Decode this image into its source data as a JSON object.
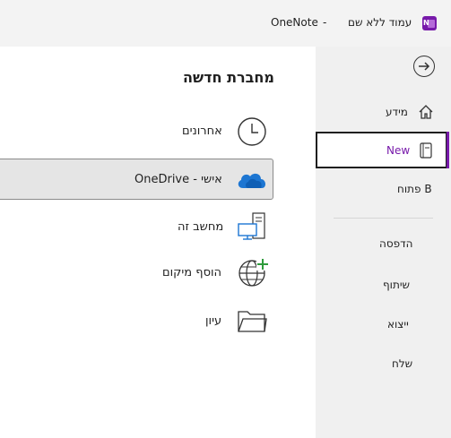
{
  "titlebar": {
    "app_name": "OneNote",
    "separator": "-",
    "page_name": "עמוד ללא שם",
    "app_icon_letter": "N"
  },
  "nav": {
    "back_icon": "arrow-right-circle-icon",
    "items": [
      {
        "label": "מידע",
        "icon": "home-icon"
      },
      {
        "label": "New",
        "icon": "notebook-icon",
        "selected": true
      },
      {
        "label": "פתוח B",
        "icon": ""
      },
      {
        "label": "הדפסה"
      },
      {
        "label": "שיתוף"
      },
      {
        "label": "ייצוא"
      },
      {
        "label": "שלח"
      }
    ],
    "accent": "#7719aa"
  },
  "main": {
    "heading": "מחברת חדשה",
    "locations": [
      {
        "label": "אחרונים",
        "icon": "clock-icon"
      },
      {
        "label": "OneDrive - אישי",
        "icon": "onedrive-cloud-icon",
        "selected": true
      },
      {
        "label": "מחשב זה",
        "icon": "computer-icon"
      },
      {
        "label": "הוסף מיקום",
        "icon": "globe-add-icon"
      },
      {
        "label": "עיון",
        "icon": "folder-icon"
      }
    ]
  }
}
